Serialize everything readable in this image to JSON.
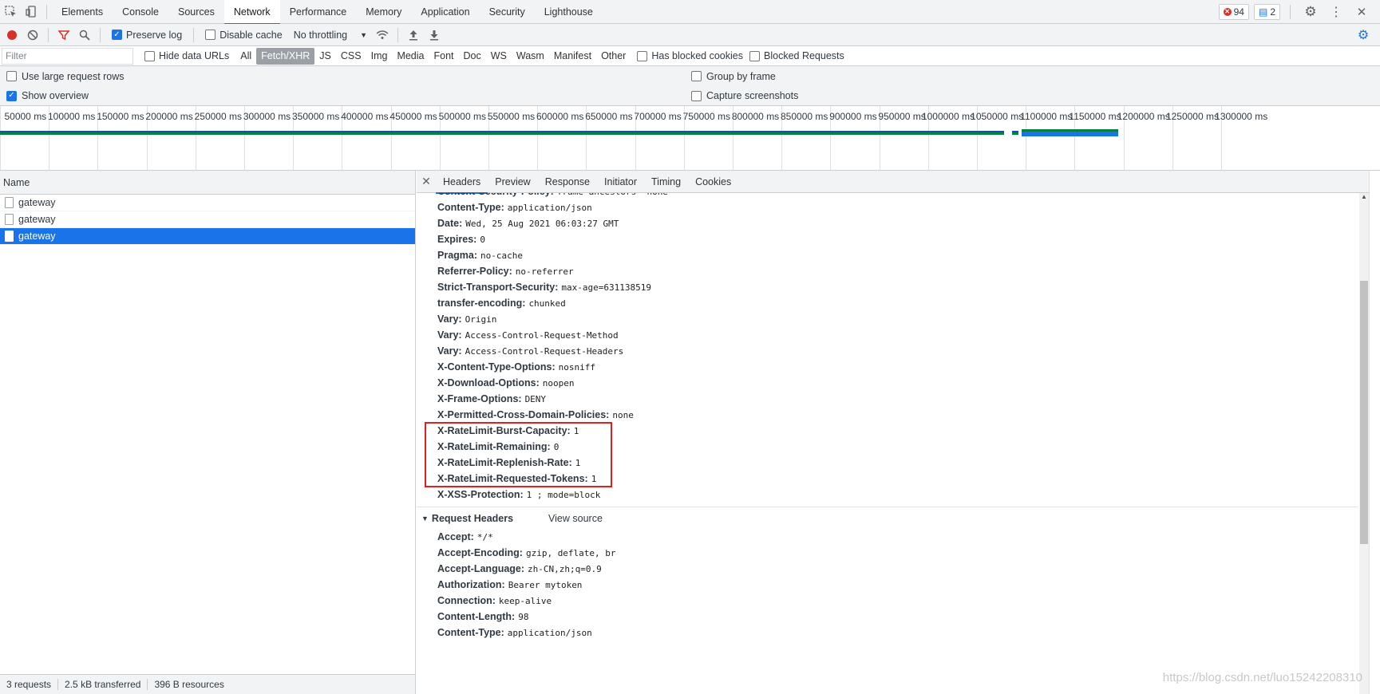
{
  "tabs": {
    "items": [
      "Elements",
      "Console",
      "Sources",
      "Network",
      "Performance",
      "Memory",
      "Application",
      "Security",
      "Lighthouse"
    ],
    "active": "Network",
    "errors": "94",
    "messages": "2"
  },
  "toolbar": {
    "preserve_log": "Preserve log",
    "disable_cache": "Disable cache",
    "throttling": "No throttling"
  },
  "filter": {
    "placeholder": "Filter",
    "hide_data_urls": "Hide data URLs",
    "types": [
      "All",
      "Fetch/XHR",
      "JS",
      "CSS",
      "Img",
      "Media",
      "Font",
      "Doc",
      "WS",
      "Wasm",
      "Manifest",
      "Other"
    ],
    "active_type": "Fetch/XHR",
    "has_blocked_cookies": "Has blocked cookies",
    "blocked_requests": "Blocked Requests"
  },
  "options": {
    "large_rows": "Use large request rows",
    "show_overview": "Show overview",
    "group_by_frame": "Group by frame",
    "capture_screenshots": "Capture screenshots"
  },
  "overview": {
    "ticks": [
      "50000 ms",
      "100000 ms",
      "150000 ms",
      "200000 ms",
      "250000 ms",
      "300000 ms",
      "350000 ms",
      "400000 ms",
      "450000 ms",
      "500000 ms",
      "550000 ms",
      "600000 ms",
      "650000 ms",
      "700000 ms",
      "750000 ms",
      "800000 ms",
      "850000 ms",
      "900000 ms",
      "950000 ms",
      "1000000 ms",
      "1050000 ms",
      "1100000 ms",
      "1150000 ms",
      "1200000 ms",
      "1250000 ms",
      "1300000 ms"
    ]
  },
  "requests": {
    "column": "Name",
    "rows": [
      {
        "name": "gateway",
        "selected": false
      },
      {
        "name": "gateway",
        "selected": false
      },
      {
        "name": "gateway",
        "selected": true
      }
    ]
  },
  "details": {
    "tabs": [
      "Headers",
      "Preview",
      "Response",
      "Initiator",
      "Timing",
      "Cookies"
    ],
    "active_tab": "Headers",
    "response_headers": [
      {
        "k": "Content-Security-Policy:",
        "v": "frame-ancestors 'none'"
      },
      {
        "k": "Content-Type:",
        "v": "application/json"
      },
      {
        "k": "Date:",
        "v": "Wed, 25 Aug 2021 06:03:27 GMT"
      },
      {
        "k": "Expires:",
        "v": "0"
      },
      {
        "k": "Pragma:",
        "v": "no-cache"
      },
      {
        "k": "Referrer-Policy:",
        "v": "no-referrer"
      },
      {
        "k": "Strict-Transport-Security:",
        "v": "max-age=631138519"
      },
      {
        "k": "transfer-encoding:",
        "v": "chunked"
      },
      {
        "k": "Vary:",
        "v": "Origin"
      },
      {
        "k": "Vary:",
        "v": "Access-Control-Request-Method"
      },
      {
        "k": "Vary:",
        "v": "Access-Control-Request-Headers"
      },
      {
        "k": "X-Content-Type-Options:",
        "v": "nosniff"
      },
      {
        "k": "X-Download-Options:",
        "v": "noopen"
      },
      {
        "k": "X-Frame-Options:",
        "v": "DENY"
      },
      {
        "k": "X-Permitted-Cross-Domain-Policies:",
        "v": "none"
      },
      {
        "k": "X-RateLimit-Burst-Capacity:",
        "v": "1"
      },
      {
        "k": "X-RateLimit-Remaining:",
        "v": "0"
      },
      {
        "k": "X-RateLimit-Replenish-Rate:",
        "v": "1"
      },
      {
        "k": "X-RateLimit-Requested-Tokens:",
        "v": "1"
      },
      {
        "k": "X-XSS-Protection:",
        "v": "1 ; mode=block"
      }
    ],
    "request_section": "Request Headers",
    "view_source": "View source",
    "request_headers": [
      {
        "k": "Accept:",
        "v": "*/*"
      },
      {
        "k": "Accept-Encoding:",
        "v": "gzip, deflate, br"
      },
      {
        "k": "Accept-Language:",
        "v": "zh-CN,zh;q=0.9"
      },
      {
        "k": "Authorization:",
        "v": "Bearer mytoken"
      },
      {
        "k": "Connection:",
        "v": "keep-alive"
      },
      {
        "k": "Content-Length:",
        "v": "98"
      },
      {
        "k": "Content-Type:",
        "v": "application/json"
      }
    ]
  },
  "status": {
    "requests": "3 requests",
    "transferred": "2.5 kB transferred",
    "resources": "396 B resources"
  },
  "watermark": "https://blog.csdn.net/luo15242208310"
}
